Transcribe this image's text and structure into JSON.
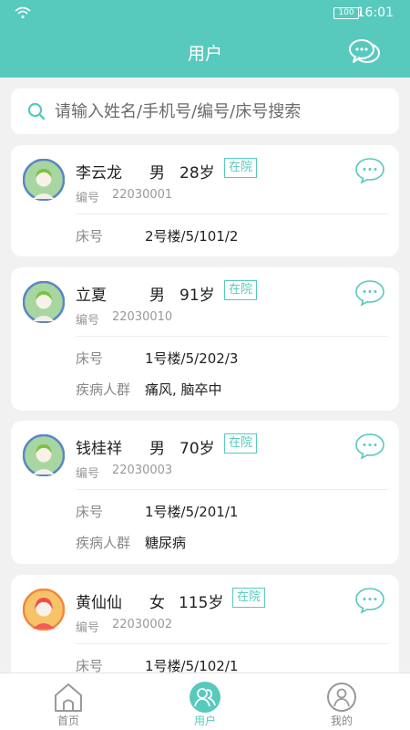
{
  "status_bar": {
    "time": "16:01",
    "battery": "100"
  },
  "header": {
    "title": "用户"
  },
  "search": {
    "placeholder": "请输入姓名/手机号/编号/床号搜索"
  },
  "labels": {
    "code": "编号",
    "bed": "床号",
    "disease": "疾病人群"
  },
  "patients": [
    {
      "name": "李云龙",
      "gender": "男",
      "age": "28岁",
      "status": "在院",
      "code": "22030001",
      "bed": "2号楼/5/101/2",
      "disease": "",
      "avatar": "boy"
    },
    {
      "name": "立夏",
      "gender": "男",
      "age": "91岁",
      "status": "在院",
      "code": "22030010",
      "bed": "1号楼/5/202/3",
      "disease": "痛风, 脑卒中",
      "avatar": "boy"
    },
    {
      "name": "钱桂祥",
      "gender": "男",
      "age": "70岁",
      "status": "在院",
      "code": "22030003",
      "bed": "1号楼/5/201/1",
      "disease": "糖尿病",
      "avatar": "boy"
    },
    {
      "name": "黄仙仙",
      "gender": "女",
      "age": "115岁",
      "status": "在院",
      "code": "22030002",
      "bed": "1号楼/5/102/1",
      "disease": "",
      "avatar": "girl"
    }
  ],
  "tabs": [
    {
      "label": "首页",
      "icon": "home-icon",
      "active": false
    },
    {
      "label": "用户",
      "icon": "users-icon",
      "active": true
    },
    {
      "label": "我的",
      "icon": "profile-icon",
      "active": false
    }
  ],
  "colors": {
    "accent": "#58c9bd",
    "background": "#f1f1f1"
  }
}
